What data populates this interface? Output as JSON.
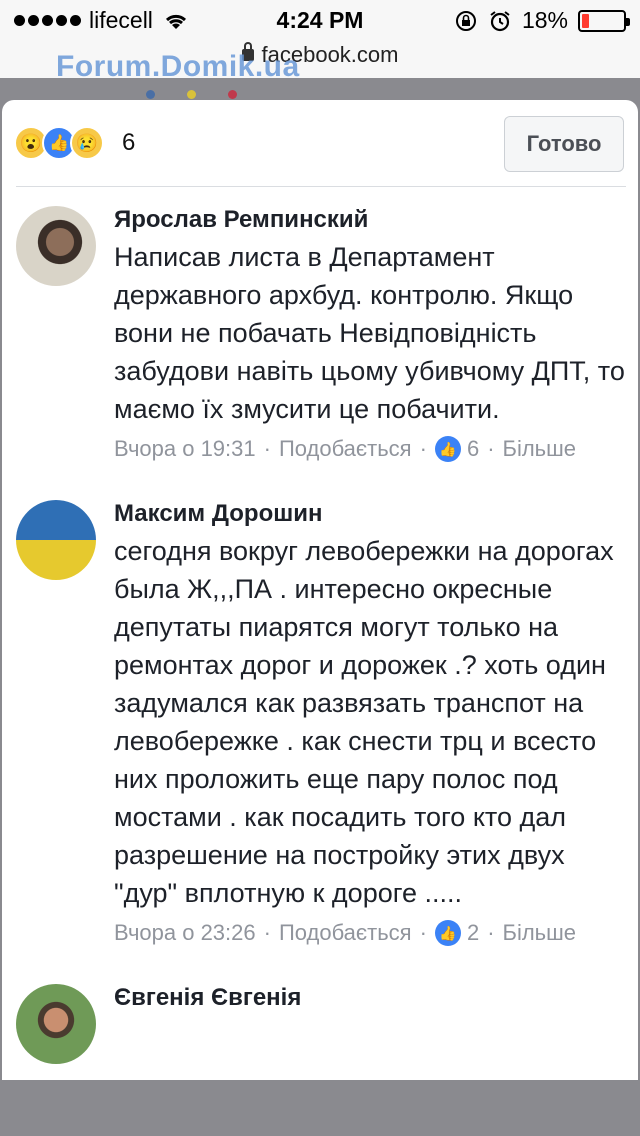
{
  "status_bar": {
    "carrier": "lifecell",
    "time": "4:24 PM",
    "battery": "18%",
    "battery_level": 0.18
  },
  "browser": {
    "url": "facebook.com"
  },
  "watermark": {
    "text": "Forum.Domik.ua"
  },
  "reactions": {
    "icons": [
      "wow-reaction-icon",
      "like-reaction-icon",
      "sad-reaction-icon"
    ],
    "count": "6"
  },
  "done_button": "Готово",
  "comments": [
    {
      "author": "Ярослав Ремпинский",
      "text": "Написав листа в Департамент державного архбуд. контролю. Якщо вони не побачать Невідповідність забудови навіть цьому убивчому ДПТ, то маємо їх змусити це побачити.",
      "time": "Вчора о 19:31",
      "like_label": "Подобається",
      "likes": "6",
      "more": "Більше"
    },
    {
      "author": "Максим Дорошин",
      "text": "сегодня вокруг левобережки на дорогах была Ж,,,ПА . интересно окресные депутаты пиарятся могут только на ремонтах дорог и дорожек .? хоть один задумался как развязать транспот на левобережке . как снести трц и всесто них проложить еще пару полос под мостами . как посадить того кто дал разрешение на постройку этих двух \"дур\" вплотную к дороге .....",
      "time": "Вчора о 23:26",
      "like_label": "Подобається",
      "likes": "2",
      "more": "Більше"
    },
    {
      "author": "Євгенія Євгенія"
    }
  ],
  "colors": {
    "facebook_blue": "#3b82f6",
    "battery_low": "#ff3b30",
    "meta_gray": "#90949c"
  }
}
